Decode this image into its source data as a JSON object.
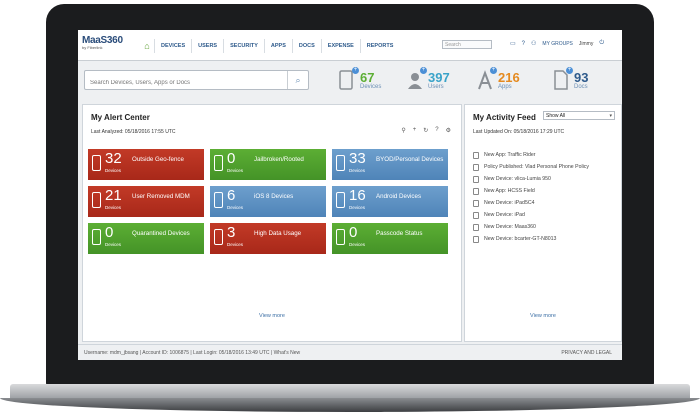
{
  "logo": {
    "line1": "MaaS360",
    "line2": "by Fiberlink"
  },
  "nav": {
    "items": [
      "DEVICES",
      "USERS",
      "SECURITY",
      "APPS",
      "DOCS",
      "EXPENSE",
      "REPORTS"
    ]
  },
  "top": {
    "search_placeholder": "Search",
    "my_groups": "MY GROUPS",
    "user": "Jimmy"
  },
  "search": {
    "placeholder": "Search Devices, Users, Apps or Docs"
  },
  "stats": [
    {
      "count": "67",
      "label": "Devices",
      "color": "#5cae34"
    },
    {
      "count": "397",
      "label": "Users",
      "color": "#3aa3c9"
    },
    {
      "count": "216",
      "label": "Apps",
      "color": "#e58a1f"
    },
    {
      "count": "93",
      "label": "Docs",
      "color": "#2f5b8c"
    }
  ],
  "alert_center": {
    "title": "My Alert Center",
    "last_analyzed": "Last Analyzed: 05/18/2016 17:55 UTC",
    "view_more": "View more",
    "tiles": [
      {
        "count": "32",
        "unit": "Devices",
        "label": "Outside Geo-fence"
      },
      {
        "count": "0",
        "unit": "Devices",
        "label": "Jailbroken/Rooted"
      },
      {
        "count": "33",
        "unit": "Devices",
        "label": "BYOD/Personal Devices"
      },
      {
        "count": "21",
        "unit": "Devices",
        "label": "User Removed MDM"
      },
      {
        "count": "6",
        "unit": "Devices",
        "label": "iOS 8 Devices"
      },
      {
        "count": "16",
        "unit": "Devices",
        "label": "Android Devices"
      },
      {
        "count": "0",
        "unit": "Devices",
        "label": "Quarantined Devices"
      },
      {
        "count": "3",
        "unit": "Devices",
        "label": "High Data Usage"
      },
      {
        "count": "0",
        "unit": "Devices",
        "label": "Passcode Status"
      }
    ]
  },
  "activity_feed": {
    "title": "My Activity Feed",
    "filter": "Show All",
    "last_updated": "Last Updated On: 05/18/2016 17:29 UTC",
    "view_more": "View more",
    "items": [
      "New App: Traffic Rider",
      "Policy Published: Vlad Personal Phone Policy",
      "New Device: vlica-Lumia 950",
      "New App: HCSS Field",
      "New Device: iPad5C4",
      "New Device: iPad",
      "New Device: Maas360",
      "New Device: bcarter-GT-N8013"
    ]
  },
  "footer": {
    "info": "Username:  mdm_jbsang  |  Account ID:  1006875  |  Last Login: 05/18/2016 13:49 UTC  |  What's New",
    "right": "PRIVACY AND LEGAL"
  }
}
